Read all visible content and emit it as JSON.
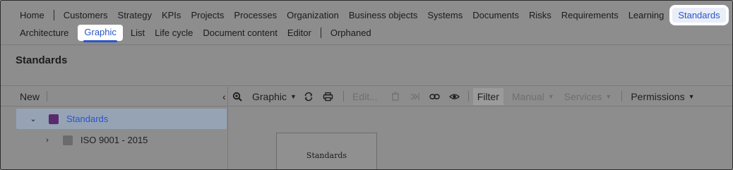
{
  "nav": {
    "row1": [
      "Home",
      "Customers",
      "Strategy",
      "KPIs",
      "Projects",
      "Processes",
      "Organization",
      "Business objects",
      "Systems",
      "Documents",
      "Risks",
      "Requirements",
      "Learning",
      "Standards"
    ],
    "row2": [
      "Architecture",
      "Graphic",
      "List",
      "Life cycle",
      "Document content",
      "Editor",
      "Orphaned"
    ]
  },
  "page": {
    "title": "Standards"
  },
  "toolbar": {
    "new_label": "New",
    "graphic_label": "Graphic",
    "edit_label": "Edit...",
    "filter_label": "Filter",
    "manual_label": "Manual",
    "services_label": "Services",
    "permissions_label": "Permissions"
  },
  "tree": [
    {
      "label": "Standards",
      "color": "#5a2a6e",
      "expanded": true
    },
    {
      "label": "ISO 9001 - 2015",
      "color": "#6b6b6b",
      "expanded": false
    }
  ],
  "canvas": {
    "node_label": "Standards"
  },
  "colors": {
    "accent": "#2a55c9",
    "selected_row": "#96a3b5"
  }
}
